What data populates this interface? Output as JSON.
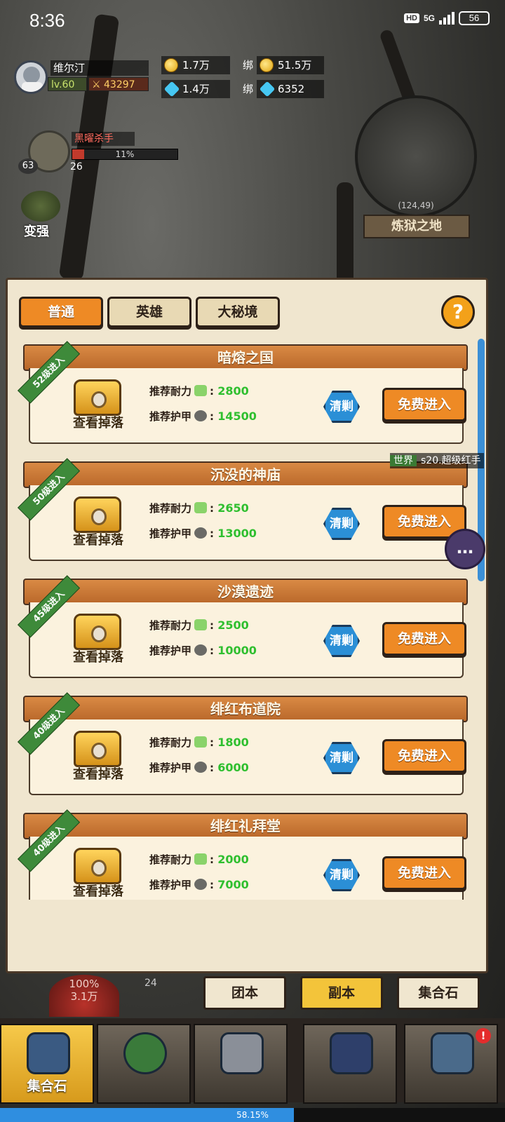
{
  "status_bar": {
    "time": "8:36",
    "hd": "HD",
    "network": "5G",
    "battery": "56"
  },
  "player": {
    "name": "维尔汀",
    "level": "lv.60",
    "power": "43297"
  },
  "resources": {
    "gold": "1.7万",
    "bound_gold_prefix": "绑",
    "bound_gold": "51.5万",
    "diamond": "1.4万",
    "bound_diamond_prefix": "绑",
    "bound_diamond": "6352"
  },
  "boss": {
    "name": "黑曜杀手",
    "hp_percent": "11%",
    "hp_fraction": 0.11,
    "level": "63",
    "count": "26"
  },
  "side": {
    "strengthen": "变强"
  },
  "minimap": {
    "coords": "(124,49)",
    "location": "炼狱之地"
  },
  "tabs": [
    {
      "label": "普通",
      "active": true
    },
    {
      "label": "英雄",
      "active": false
    },
    {
      "label": "大秘境",
      "active": false
    }
  ],
  "help_label": "?",
  "dungeon_list": [
    {
      "name": "暗熔之国",
      "ribbon": "52级进入",
      "view_drop": "查看掉落",
      "stamina_label": "推荐耐力",
      "stamina": "2800",
      "armor_label": "推荐护甲",
      "armor": "14500",
      "sweep": "清剿",
      "enter": "免费进入"
    },
    {
      "name": "沉没的神庙",
      "ribbon": "50级进入",
      "view_drop": "查看掉落",
      "stamina_label": "推荐耐力",
      "stamina": "2650",
      "armor_label": "推荐护甲",
      "armor": "13000",
      "sweep": "清剿",
      "enter": "免费进入"
    },
    {
      "name": "沙漠遗迹",
      "ribbon": "45级进入",
      "view_drop": "查看掉落",
      "stamina_label": "推荐耐力",
      "stamina": "2500",
      "armor_label": "推荐护甲",
      "armor": "10000",
      "sweep": "清剿",
      "enter": "免费进入"
    },
    {
      "name": "绯红布道院",
      "ribbon": "40级进入",
      "view_drop": "查看掉落",
      "stamina_label": "推荐耐力",
      "stamina": "1800",
      "armor_label": "推荐护甲",
      "armor": "6000",
      "sweep": "清剿",
      "enter": "免费进入"
    },
    {
      "name": "绯红礼拜堂",
      "ribbon": "40级进入",
      "view_drop": "查看掉落",
      "stamina_label": "推荐耐力",
      "stamina": "2000",
      "armor_label": "推荐护甲",
      "armor": "7000",
      "sweep": "清剿",
      "enter": "免费进入"
    }
  ],
  "chat": {
    "channel": "世界",
    "message": "s20.超级红手"
  },
  "orb": {
    "percent": "100%",
    "value": "3.1万"
  },
  "orb_slot": "24",
  "sub_tabs": [
    {
      "label": "团本",
      "active": false
    },
    {
      "label": "副本",
      "active": true
    },
    {
      "label": "集合石",
      "active": false
    }
  ],
  "bottom_nav": [
    {
      "label": "集合石",
      "icon": "stone-icon",
      "active": true
    },
    {
      "label": "",
      "icon": "hooded-hero-icon",
      "active": false
    },
    {
      "label": "",
      "icon": "crossed-swords-icon",
      "active": false
    },
    {
      "label": "",
      "icon": "gate-icon",
      "active": false
    },
    {
      "label": "",
      "icon": "castle-icon",
      "active": false,
      "badge": "!"
    }
  ],
  "xp": {
    "text": "58.15%",
    "fraction": 0.5815
  },
  "colors": {
    "accent_orange": "#ee8a25",
    "panel_bg": "#f0e6cf",
    "ribbon_green": "#3e8a3a",
    "value_green": "#2fbf2f",
    "sweep_blue": "#2b8fd6"
  }
}
